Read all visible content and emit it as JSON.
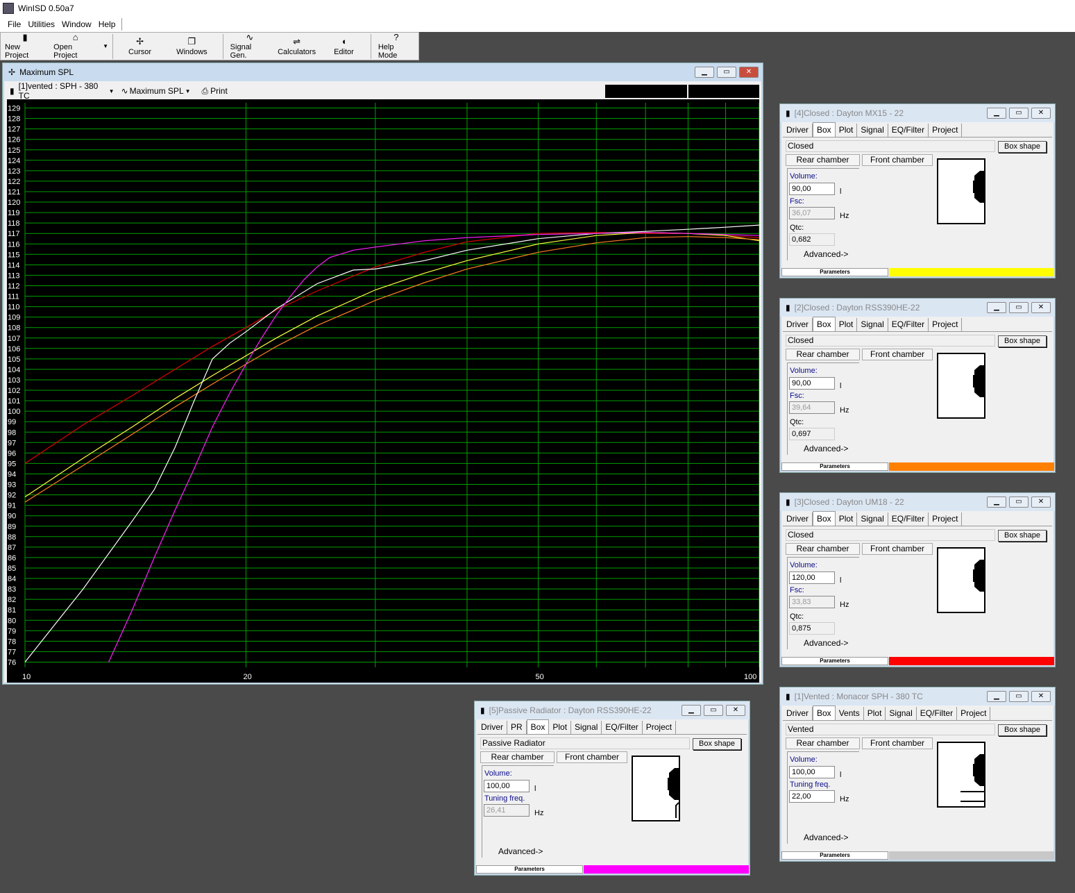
{
  "app": {
    "title": "WinISD 0.50a7"
  },
  "menu": [
    "File",
    "Utilities",
    "Window",
    "Help"
  ],
  "toolbar": [
    {
      "label": "New Project",
      "icon": "new-project-icon",
      "glyph": "▮"
    },
    {
      "label": "Open Project",
      "icon": "open-project-icon",
      "glyph": "⌂"
    },
    {
      "label": "Cursor",
      "icon": "cursor-icon",
      "glyph": "✢"
    },
    {
      "label": "Windows",
      "icon": "windows-icon",
      "glyph": "❐"
    },
    {
      "label": "Signal Gen.",
      "icon": "signal-gen-icon",
      "glyph": "∿"
    },
    {
      "label": "Calculators",
      "icon": "calculators-icon",
      "glyph": "⇌"
    },
    {
      "label": "Editor",
      "icon": "editor-icon",
      "glyph": "◖"
    },
    {
      "label": "Help Mode",
      "icon": "help-mode-icon",
      "glyph": "?"
    }
  ],
  "graph": {
    "title": "Maximum SPL",
    "project_select": "[1]vented : SPH - 380 TC",
    "plot_select": "Maximum SPL",
    "print_label": "Print",
    "bg": "#000000",
    "grid": "#00a000"
  },
  "chart_data": {
    "type": "line",
    "xscale": "log",
    "xlim": [
      10,
      100
    ],
    "xticks": [
      "10",
      "20",
      "50",
      "100"
    ],
    "ylim": [
      75.5,
      129.5
    ],
    "yticks": [
      76,
      77,
      78,
      79,
      80,
      81,
      82,
      83,
      84,
      85,
      86,
      87,
      88,
      89,
      90,
      91,
      92,
      93,
      94,
      95,
      96,
      97,
      98,
      99,
      100,
      101,
      102,
      103,
      104,
      105,
      106,
      107,
      108,
      109,
      110,
      111,
      112,
      113,
      114,
      115,
      116,
      117,
      118,
      119,
      120,
      121,
      122,
      123,
      124,
      125,
      126,
      127,
      128,
      129
    ],
    "series": [
      {
        "color": "#e00000",
        "x": [
          10,
          12,
          14,
          16,
          18,
          20,
          22,
          25,
          30,
          35,
          40,
          50,
          60,
          70,
          80,
          90,
          100
        ],
        "y": [
          95,
          98.7,
          101.5,
          104,
          106.2,
          108,
          109.7,
          111.5,
          113.8,
          115.2,
          116.2,
          117,
          117.1,
          117,
          117,
          116.8,
          116.6
        ]
      },
      {
        "color": "#ffff40",
        "x": [
          10,
          12,
          14,
          16,
          18,
          20,
          22,
          25,
          30,
          35,
          40,
          50,
          60,
          70,
          80,
          90,
          100
        ],
        "y": [
          91.8,
          95.5,
          98.5,
          101.2,
          103.4,
          105.3,
          107,
          109.1,
          111.6,
          113.2,
          114.4,
          116,
          116.8,
          117.1,
          117,
          116.8,
          116.3
        ]
      },
      {
        "color": "#ff8020",
        "x": [
          10,
          12,
          14,
          16,
          18,
          20,
          22,
          25,
          30,
          35,
          40,
          50,
          60,
          70,
          80,
          90,
          100
        ],
        "y": [
          91.3,
          94.8,
          97.8,
          100.4,
          102.6,
          104.5,
          106.2,
          108.2,
          110.6,
          112.3,
          113.6,
          115.2,
          116.1,
          116.6,
          116.7,
          116.6,
          116.4
        ]
      },
      {
        "color": "#ffffff",
        "x": [
          10,
          12,
          14,
          15,
          16,
          17,
          18,
          19,
          20,
          22,
          25,
          28,
          30,
          35,
          40,
          50,
          60,
          70,
          80,
          90,
          100
        ],
        "y": [
          76,
          83,
          89.5,
          92.5,
          96.5,
          101,
          105,
          106.5,
          107.6,
          109.8,
          112.2,
          113.5,
          113.6,
          114.4,
          115.4,
          116.5,
          117,
          117.2,
          117.4,
          117.6,
          117.8
        ]
      },
      {
        "color": "#ff20ff",
        "x": [
          13,
          14,
          15,
          16,
          17,
          18,
          19,
          20,
          21,
          22,
          23,
          24,
          25,
          26,
          28,
          30,
          35,
          40,
          50,
          60,
          70,
          80,
          90,
          100
        ],
        "y": [
          76,
          81,
          86,
          90.5,
          94.5,
          98.5,
          101.7,
          104.5,
          107,
          109.2,
          111,
          112.6,
          113.8,
          114.7,
          115.4,
          115.7,
          116.3,
          116.6,
          116.9,
          117,
          117.1,
          117,
          116.9,
          116.8
        ]
      }
    ]
  },
  "windows": [
    {
      "title": "[4]Closed : Dayton MX15 - 22",
      "tabs": [
        "Driver",
        "Box",
        "Plot",
        "Signal",
        "EQ/Filter",
        "Project"
      ],
      "sel": 1,
      "type": "Closed",
      "box_shape": "Box shape",
      "rear": "Rear chamber",
      "front": "Front chamber",
      "f1_label": "Volume:",
      "f1_value": "90,00",
      "f1_unit": "l",
      "f2_label": "Fsc:",
      "f2_value": "36,07",
      "f2_unit": "Hz",
      "f3_label": "Qtc:",
      "f3_value": "0,682",
      "advanced": "Advanced->",
      "params": "Parameters",
      "color": "#ffff00"
    },
    {
      "title": "[2]Closed : Dayton RSS390HE-22",
      "tabs": [
        "Driver",
        "Box",
        "Plot",
        "Signal",
        "EQ/Filter",
        "Project"
      ],
      "sel": 1,
      "type": "Closed",
      "box_shape": "Box shape",
      "rear": "Rear chamber",
      "front": "Front chamber",
      "f1_label": "Volume:",
      "f1_value": "90,00",
      "f1_unit": "l",
      "f2_label": "Fsc:",
      "f2_value": "39,64",
      "f2_unit": "Hz",
      "f3_label": "Qtc:",
      "f3_value": "0,697",
      "advanced": "Advanced->",
      "params": "Parameters",
      "color": "#ff8000"
    },
    {
      "title": "[3]Closed : Dayton UM18 - 22",
      "tabs": [
        "Driver",
        "Box",
        "Plot",
        "Signal",
        "EQ/Filter",
        "Project"
      ],
      "sel": 1,
      "type": "Closed",
      "box_shape": "Box shape",
      "rear": "Rear chamber",
      "front": "Front chamber",
      "f1_label": "Volume:",
      "f1_value": "120,00",
      "f1_unit": "l",
      "f2_label": "Fsc:",
      "f2_value": "33,83",
      "f2_unit": "Hz",
      "f3_label": "Qtc:",
      "f3_value": "0,875",
      "advanced": "Advanced->",
      "params": "Parameters",
      "color": "#ff0000"
    },
    {
      "title": "[1]Vented : Monacor SPH - 380 TC",
      "tabs": [
        "Driver",
        "Box",
        "Vents",
        "Plot",
        "Signal",
        "EQ/Filter",
        "Project"
      ],
      "sel": 1,
      "type": "Vented",
      "box_shape": "Box shape",
      "rear": "Rear chamber",
      "front": "Front chamber",
      "f1_label": "Volume:",
      "f1_value": "100,00",
      "f1_unit": "l",
      "f2_label": "Tuning freq.",
      "f2_value": "22,00",
      "f2_unit": "Hz",
      "advanced": "Advanced->",
      "params": "Parameters",
      "color": "#c8c8c8"
    },
    {
      "title": "[5]Passive Radiator : Dayton RSS390HE-22",
      "tabs": [
        "Driver",
        "PR",
        "Box",
        "Plot",
        "Signal",
        "EQ/Filter",
        "Project"
      ],
      "sel": 2,
      "type": "Passive Radiator",
      "box_shape": "Box shape",
      "rear": "Rear chamber",
      "front": "Front chamber",
      "f1_label": "Volume:",
      "f1_value": "100,00",
      "f1_unit": "l",
      "f2_label": "Tuning freq.",
      "f2_value": "26,41",
      "f2_unit": "Hz",
      "advanced": "Advanced->",
      "params": "Parameters",
      "color": "#ff00ff"
    }
  ]
}
